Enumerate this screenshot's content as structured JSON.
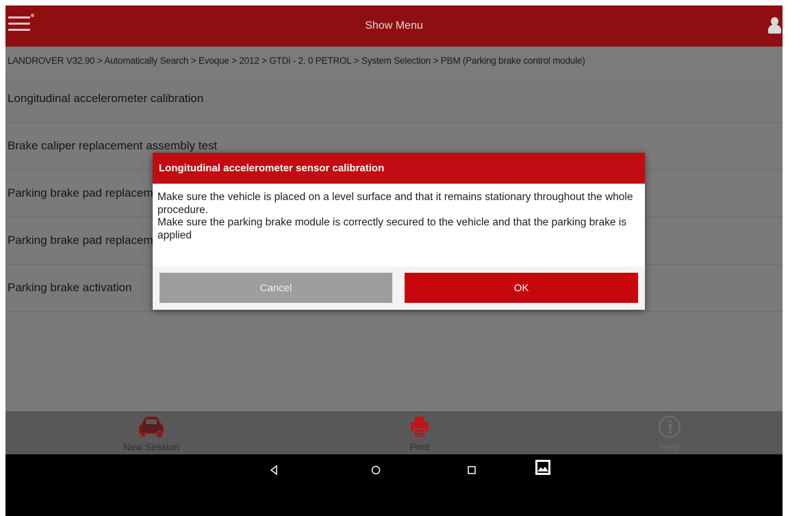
{
  "topbar": {
    "title": "Show Menu",
    "menu_icon": "hamburger-menu-icon",
    "user_icon": "user-icon"
  },
  "breadcrumb": {
    "text": "LANDROVER V32.90 > Automatically Search > Evoque > 2012 > GTDi - 2. 0 PETROL > System Selection > PBM (Parking brake control module)"
  },
  "list": {
    "items": [
      {
        "label": "Longitudinal accelerometer calibration"
      },
      {
        "label": "Brake caliper replacement assembly test"
      },
      {
        "label": "Parking brake pad replacement"
      },
      {
        "label": "Parking brake pad replacement"
      },
      {
        "label": "Parking brake activation"
      }
    ]
  },
  "dialog": {
    "title": "Longitudinal accelerometer sensor calibration",
    "line1": "Make sure the vehicle is placed on a level surface and that it remains stationary throughout the whole procedure.",
    "line2": "Make sure the parking brake module is correctly secured to the vehicle and that the parking brake is applied",
    "cancel_label": "Cancel",
    "ok_label": "OK"
  },
  "toolbar": {
    "new_session_label": "New Session",
    "print_label": "Print",
    "help_label": "Help"
  },
  "navbar": {
    "buttons": [
      "back-icon",
      "home-icon",
      "recents-icon",
      "screenshot-icon"
    ]
  },
  "colors": {
    "header_red": "#8e0f11",
    "dialog_red": "#c20b12",
    "ok_red": "#c8070d",
    "cancel_gray": "#9e9e9e",
    "overlay_gray": "#7a7a7a"
  }
}
